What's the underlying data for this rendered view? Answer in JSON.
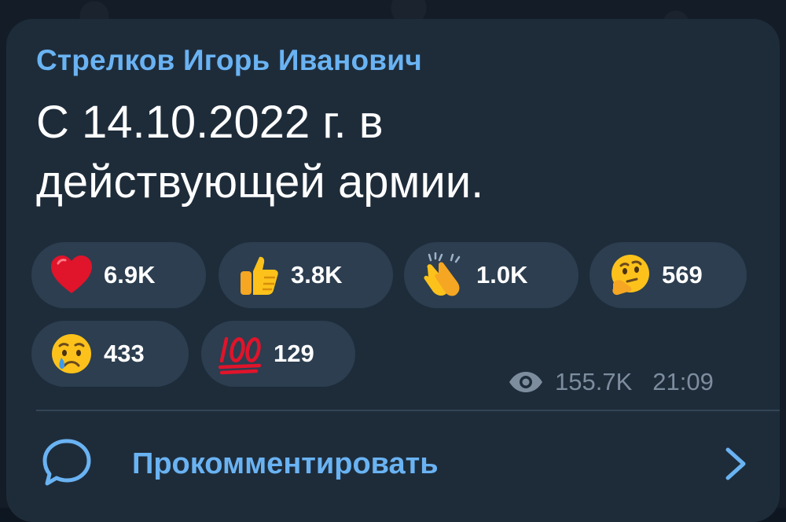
{
  "post": {
    "author": "Стрелков Игорь Иванович",
    "text": "С 14.10.2022 г. в\nдействующей армии."
  },
  "reactions": [
    {
      "icon": "red-heart-icon",
      "count": "6.9K"
    },
    {
      "icon": "thumbs-up-icon",
      "count": "3.8K"
    },
    {
      "icon": "clapping-hands-icon",
      "count": "1.0K"
    },
    {
      "icon": "thinking-face-icon",
      "count": "569"
    },
    {
      "icon": "crying-face-icon",
      "count": "433"
    },
    {
      "icon": "hundred-points-icon",
      "count": "129"
    }
  ],
  "meta": {
    "views": "155.7K",
    "time": "21:09",
    "views_icon": "eye-icon"
  },
  "comments": {
    "label": "Прокомментировать",
    "icon": "comment-bubble-icon",
    "chevron": "chevron-right-icon"
  },
  "colors": {
    "background": "#131c27",
    "bubble": "#1e2c3a",
    "reaction_pill": "#2c3e50",
    "accent": "#6ab3f3",
    "meta_text": "#7d8d9e"
  }
}
